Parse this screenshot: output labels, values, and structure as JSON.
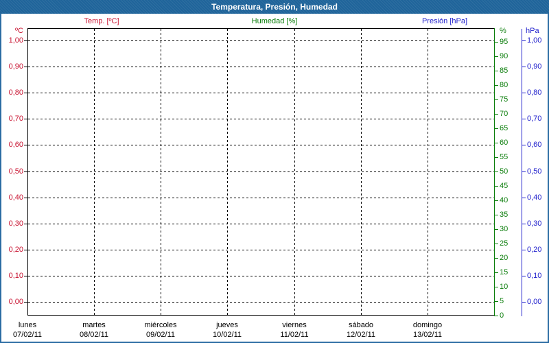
{
  "window": {
    "title": "Temperatura, Presión, Humedad",
    "colors": {
      "titlebar_bg": "#1f649a",
      "window_border": "#2b6ca3",
      "temp": "#c8102e",
      "humidity": "#0a7d0a",
      "pressure": "#2020cc",
      "grid": "#000000",
      "background": "#ffffff"
    }
  },
  "legend": {
    "temp_label": "Temp. [ºC]",
    "humidity_label": "Humedad [%]",
    "pressure_label": "Presión [hPa]"
  },
  "axes": {
    "left_temp": {
      "header": "ºC",
      "labels": [
        "1,00",
        "0,90",
        "0,80",
        "0,70",
        "0,60",
        "0,50",
        "0,40",
        "0,30",
        "0,20",
        "0,10",
        "0,00"
      ]
    },
    "right_humidity": {
      "header": "%",
      "labels": [
        "95",
        "90",
        "85",
        "80",
        "75",
        "70",
        "65",
        "60",
        "55",
        "50",
        "45",
        "40",
        "35",
        "30",
        "25",
        "20",
        "15",
        "10",
        "5",
        "0"
      ]
    },
    "right_pressure": {
      "header": "hPa",
      "labels": [
        "1,00",
        "0,90",
        "0,80",
        "0,70",
        "0,60",
        "0,50",
        "0,40",
        "0,30",
        "0,20",
        "0,10",
        "0,00"
      ]
    },
    "x_days": {
      "names": [
        "lunes",
        "martes",
        "miércoles",
        "jueves",
        "viernes",
        "sábado",
        "domingo"
      ],
      "dates": [
        "07/02/11",
        "08/02/11",
        "09/02/11",
        "10/02/11",
        "11/02/11",
        "12/02/11",
        "13/02/11"
      ]
    }
  },
  "chart_data": {
    "type": "line",
    "title": "Temperatura, Presión, Humedad",
    "grid": true,
    "legend_position": "top",
    "x_axis": {
      "tick_days": [
        "lunes",
        "martes",
        "miércoles",
        "jueves",
        "viernes",
        "sábado",
        "domingo"
      ],
      "tick_dates": [
        "07/02/11",
        "08/02/11",
        "09/02/11",
        "10/02/11",
        "11/02/11",
        "12/02/11",
        "13/02/11"
      ],
      "range": [
        "07/02/11",
        "13/02/11"
      ]
    },
    "y_axes": [
      {
        "id": "temp",
        "label": "ºC",
        "side": "left",
        "min": 0.0,
        "max": 1.0,
        "step": 0.1,
        "decimal_comma": true,
        "color": "#c8102e"
      },
      {
        "id": "humedad",
        "label": "%",
        "side": "right",
        "min": 0,
        "max": 100,
        "step": 5,
        "color": "#0a7d0a"
      },
      {
        "id": "presion",
        "label": "hPa",
        "side": "right",
        "min": 0.0,
        "max": 1.0,
        "step": 0.1,
        "decimal_comma": true,
        "color": "#2020cc"
      }
    ],
    "series": [
      {
        "name": "Temp. [ºC]",
        "axis": "temp",
        "color": "#c8102e",
        "x": [],
        "values": []
      },
      {
        "name": "Humedad [%]",
        "axis": "humedad",
        "color": "#0a7d0a",
        "x": [],
        "values": []
      },
      {
        "name": "Presión [hPa]",
        "axis": "presion",
        "color": "#2020cc",
        "x": [],
        "values": []
      }
    ]
  }
}
